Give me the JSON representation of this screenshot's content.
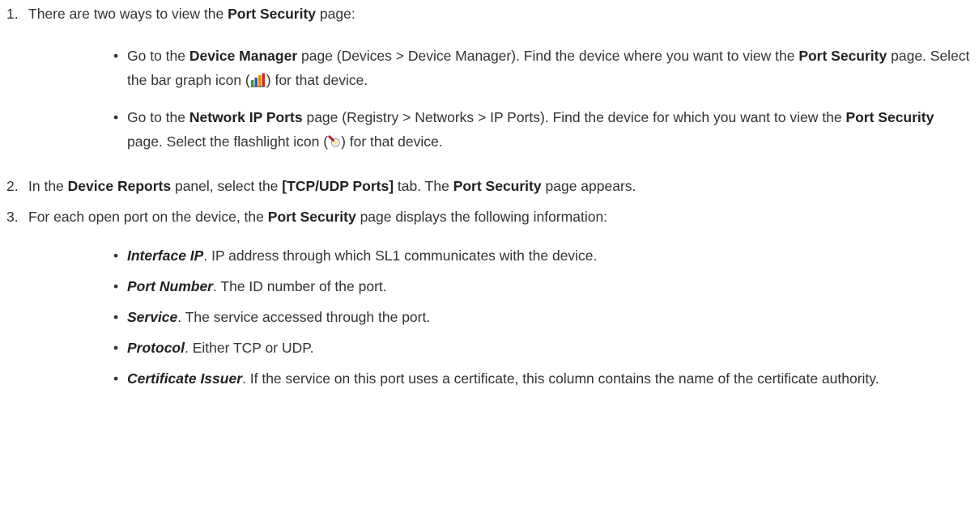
{
  "steps": [
    {
      "number": "1.",
      "intro": "There are two ways to view the",
      "intro_bold": "Port Security",
      "intro_end": "page:",
      "options": [
        {
          "t1": "Go to the",
          "b1": "Device Manager",
          "t2": "page (Devices > Device Manager). Find the device where you want to view the",
          "b2": "Port Security",
          "t3": "page. Select the bar graph icon (",
          "icon": "bar-graph-icon",
          "t4": ") for that device."
        },
        {
          "t1": "Go to the",
          "b1": "Network IP Ports",
          "t2": "page (Registry > Networks > IP Ports). Find the device for which you want to view the",
          "b2": "Port Security",
          "t3": "page. Select the flashlight icon (",
          "icon": "flashlight-icon",
          "t4": ") for that device."
        }
      ]
    },
    {
      "number": "2.",
      "t1": "In the",
      "b1": "Device Reports",
      "t2": "panel, select the",
      "b2": "[TCP/UDP Ports]",
      "t3": "tab. The",
      "b3": "Port Security",
      "t4": "page appears."
    },
    {
      "number": "3.",
      "t1": "For each open port on the device, the",
      "b1": "Port Security",
      "t2": "page displays the following information:",
      "fields": [
        {
          "term": "Interface IP",
          "desc": ". IP address through which SL1 communicates with the device."
        },
        {
          "term": "Port Number",
          "desc": ". The ID number of the port."
        },
        {
          "term": "Service",
          "desc": ". The service accessed through the port."
        },
        {
          "term": "Protocol",
          "desc": ". Either TCP or UDP."
        },
        {
          "term": "Certificate Issuer",
          "desc": ". If the service on this port uses a certificate, this column contains the name of the certificate authority."
        }
      ]
    }
  ],
  "bullet": "•",
  "colors": {
    "text": "#333333",
    "bar_red": "#d9261c",
    "bar_orange": "#f08a00",
    "bar_green": "#3a9d23",
    "bar_blue": "#1f5fbf",
    "flashlight_red": "#c8102e"
  }
}
